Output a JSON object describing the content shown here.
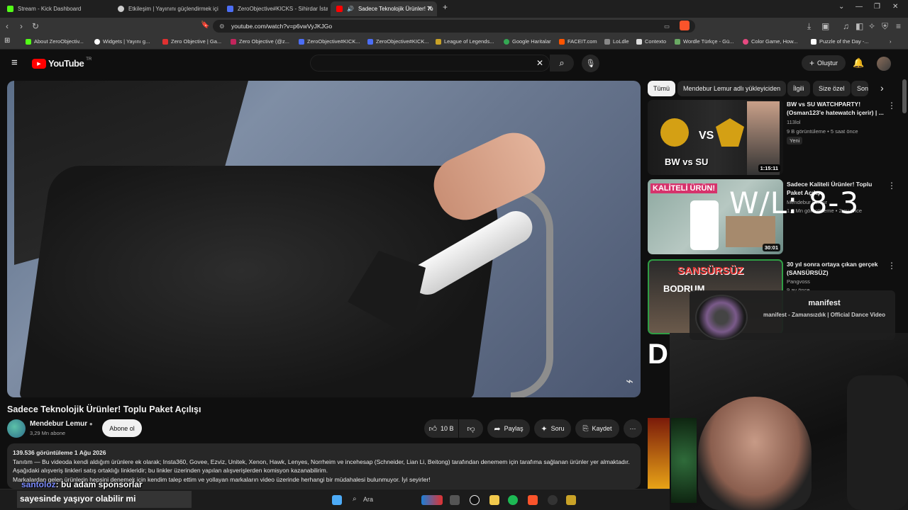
{
  "browser": {
    "tabs": [
      {
        "title": "Stream - Kick Dashboard",
        "color": "#53fc18",
        "active": false
      },
      {
        "title": "Etkileşim | Yayınını güçlendirmek için",
        "color": "#cccccc",
        "active": false
      },
      {
        "title": "ZeroObjective#KICKS - Sihirdar İstatis",
        "color": "#4c6ef5",
        "active": false
      },
      {
        "title": "Sadece Teknolojik Ürünler! To",
        "color": "#ff0000",
        "active": true
      }
    ],
    "url": "youtube.com/watch?v=p6vwVyJKJGo",
    "bookmarks": [
      {
        "label": "About ZeroObjectiv...",
        "color": "#53fc18"
      },
      {
        "label": "Widgets | Yayını g...",
        "color": "#ffffff"
      },
      {
        "label": "Zero Objective | Ga...",
        "color": "#e03131"
      },
      {
        "label": "Zero Objective (@z...",
        "color": "#c2255c"
      },
      {
        "label": "ZeroObjective#KICK...",
        "color": "#4c6ef5"
      },
      {
        "label": "ZeroObjective#KICK...",
        "color": "#4c6ef5"
      },
      {
        "label": "League of Legends...",
        "color": "#c9a227"
      },
      {
        "label": "Google Haritalar",
        "color": "#34a853"
      },
      {
        "label": "FACEIT.com",
        "color": "#ff5500"
      },
      {
        "label": "LoLdle",
        "color": "#888888"
      },
      {
        "label": "Contexto",
        "color": "#dddddd"
      },
      {
        "label": "Wordle Türkçe - Gü...",
        "color": "#6aaa64"
      },
      {
        "label": "Color Game, How...",
        "color": "#e64980"
      },
      {
        "label": "Puzzle of the Day -...",
        "color": "#ffffff"
      }
    ]
  },
  "youtube": {
    "logo": "YouTube",
    "region": "TR",
    "create_label": "Oluştur"
  },
  "video": {
    "title": "Sadece Teknolojik Ürünler! Toplu Paket Açılışı",
    "channel": "Mendebur Lemur",
    "subscribers": "3,29 Mn abone",
    "subscribe_label": "Abone ol",
    "likes": "10 B",
    "share_label": "Paylaş",
    "ask_label": "Soru",
    "save_label": "Kaydet"
  },
  "description": {
    "stats": "139.536 görüntüleme  1 Ağu 2026",
    "line1": "Tanıtım — Bu videoda kendi aldığım ürünlere ek olarak; Insta360, Govee, Ezviz, Unitek, Xenon, Hawk, Lenyes, Norrheim ve incehesap (Schneider, Lian Li, Beitong) tarafından denemem için tarafıma sağlanan ürünler yer almaktadır.",
    "line2": "Aşağıdaki alışveriş linkleri satış ortaklığı linkleridir; bu linkler üzerinden yapılan alışverişlerden komisyon kazanabilirim.",
    "line3": "Markalardan gelen ürünlerin hepsini denemek için kendim talep ettim ve yollayan markaların video üzerinde herhangi bir müdahalesi bulunmuyor. İyi seyirler!"
  },
  "chips": [
    "Tümü",
    "Mendebur Lemur adlı yükleyiciden",
    "İlgili",
    "Size özel",
    "Son"
  ],
  "recommendations": [
    {
      "title": "BW vs SU WATCHPARTY! (Osman123'e hatewatch içerir) | ...",
      "channel": "113lol",
      "meta": "9 B görüntüleme • 5 saat önce",
      "badge": "Yeni",
      "duration": "1:15:11"
    },
    {
      "title": "Sadece Kaliteli Ürünler! Toplu Paket Açılışı",
      "channel": "Mendebur Lemur",
      "meta": "1,3 Mn görüntüleme • 2 ay önce",
      "duration": "30:01"
    },
    {
      "title": "30 yıl sonra ortaya çıkan gerçek (SANSÜRSÜZ)",
      "channel": "Pangvoss",
      "meta": "9 ay önce"
    }
  ],
  "overlay": {
    "score": "W/L: 8-3",
    "song_title": "manifest",
    "song_subtitle": "manifest - Zamansızdık | Official Dance Video",
    "chat_user": "santoloz",
    "chat_text1": ": bu adam sponsorlar",
    "chat_text2": "sayesinde yaşıyor olabilir mi",
    "taskbar_search": "Ara"
  }
}
